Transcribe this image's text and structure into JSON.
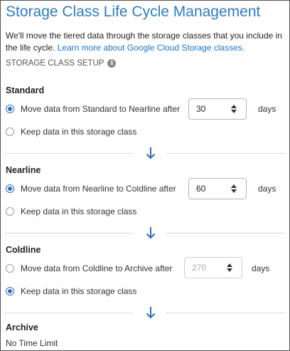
{
  "title": "Storage Class Life Cycle Management",
  "intro": {
    "text": "We'll move the tiered data through the storage classes that you include in the life cycle.",
    "link": "Learn more about Google Cloud Storage classes."
  },
  "setup_label": "STORAGE CLASS SETUP",
  "info_icon": "i",
  "days_unit": "days",
  "accent_color": "#2a6fbf",
  "sections": [
    {
      "name": "Standard",
      "move_label": "Move data from Standard to Nearline after",
      "keep_label": "Keep data in this storage class",
      "days": "30",
      "selected": "move"
    },
    {
      "name": "Nearline",
      "move_label": "Move data from Nearline to Coldline after",
      "keep_label": "Keep data in this storage class",
      "days": "60",
      "selected": "move"
    },
    {
      "name": "Coldline",
      "move_label": "Move data from Coldline to Archive after",
      "keep_label": "Keep data in this storage class",
      "days": "270",
      "selected": "keep"
    }
  ],
  "archive": {
    "name": "Archive",
    "text": "No Time Limit"
  }
}
